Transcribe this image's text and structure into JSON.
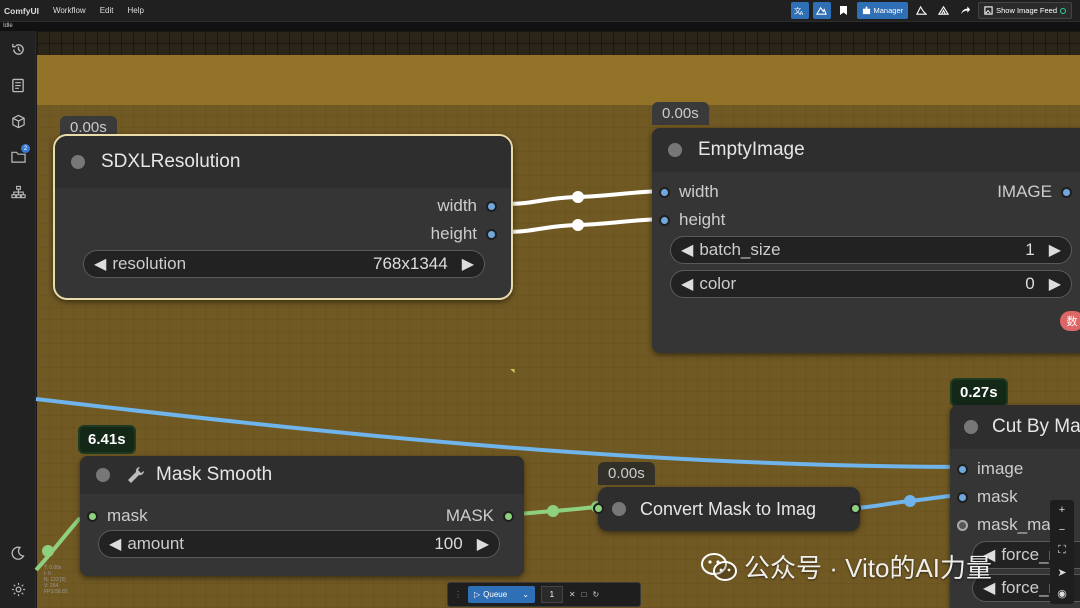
{
  "topbar": {
    "brand": "ComfyUI",
    "menu": [
      "Workflow",
      "Edit",
      "Help"
    ],
    "manager_label": "Manager",
    "feed_label": "Show Image Feed"
  },
  "status_line": "Idle",
  "sidebar": {
    "icons": [
      "history-icon",
      "queue-list-icon",
      "model-cube-icon",
      "workflows-folder-icon",
      "node-library-icon",
      "theme-moon-icon",
      "settings-gear-icon"
    ],
    "workflows_badge": "2"
  },
  "nodes": {
    "sdxl": {
      "timing": "0.00s",
      "title": "SDXLResolution",
      "outputs": [
        "width",
        "height"
      ],
      "widget": {
        "label": "resolution",
        "value": "768x1344"
      }
    },
    "empty_image": {
      "timing": "0.00s",
      "title": "EmptyImage",
      "inputs": [
        "width",
        "height"
      ],
      "output": "IMAGE",
      "widgets": [
        {
          "label": "batch_size",
          "value": "1"
        },
        {
          "label": "color",
          "value": "0"
        }
      ],
      "badge": "数"
    },
    "mask_smooth": {
      "timing": "6.41s",
      "title": "Mask Smooth",
      "input": "mask",
      "output": "MASK",
      "widget": {
        "label": "amount",
        "value": "100"
      }
    },
    "convert_mask": {
      "timing": "0.00s",
      "title": "Convert Mask to Imag"
    },
    "cut_by_mask": {
      "timing": "0.27s",
      "title": "Cut By Ma",
      "inputs": [
        "image",
        "mask",
        "mask_ma"
      ],
      "widgets": [
        "force_r",
        "force_r"
      ]
    }
  },
  "queue": {
    "label": "Queue",
    "count": "1"
  },
  "stats": [
    "T: 0.00s",
    "I: 0",
    "N: 123 [5]",
    "V: 264",
    "FPS:58.82"
  ],
  "watermark": "公众号 · Vito的AI力量"
}
